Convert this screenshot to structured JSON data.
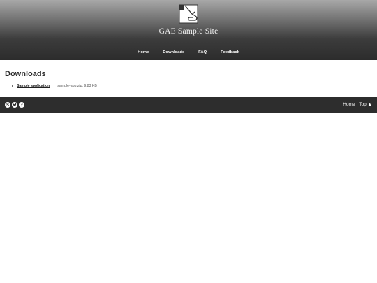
{
  "header": {
    "site_title": "GAE Sample Site",
    "logo_icon": "puzzle-logo-icon"
  },
  "nav": {
    "items": [
      {
        "label": "Home",
        "active": false
      },
      {
        "label": "Downloads",
        "active": true
      },
      {
        "label": "FAQ",
        "active": false
      },
      {
        "label": "Feedback",
        "active": false
      }
    ]
  },
  "main": {
    "title": "Downloads",
    "downloads": [
      {
        "name": "Sample application",
        "meta": "sample-app.zip, 9.83 KB"
      }
    ]
  },
  "footer": {
    "social_icons": [
      "skype-icon",
      "twitter-icon",
      "facebook-icon"
    ],
    "home_label": "Home",
    "separator": "|",
    "top_label": "Top ▲"
  },
  "colors": {
    "header_top": "#a8a8a8",
    "header_bottom": "#2c2c2c",
    "footer_bg": "#2d2d2d"
  }
}
